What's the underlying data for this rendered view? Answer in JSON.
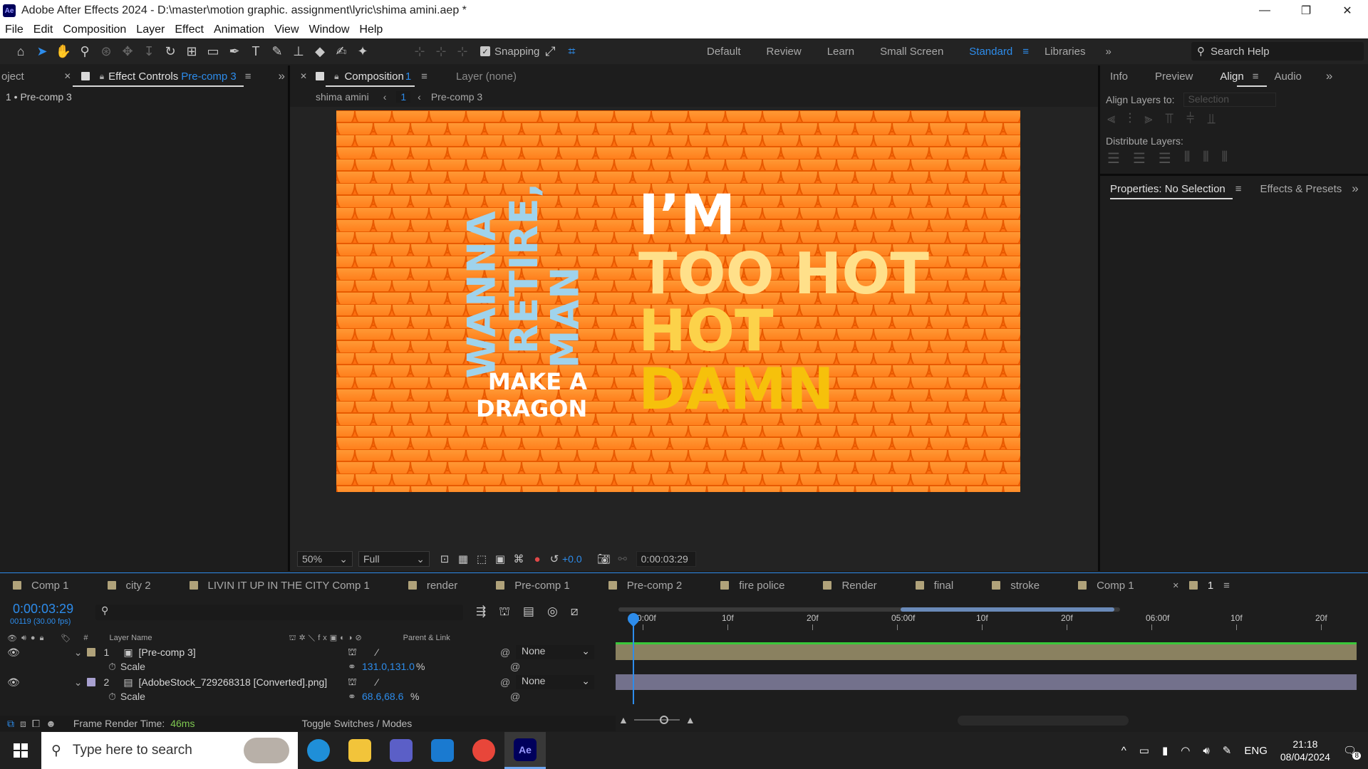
{
  "window": {
    "title": "Adobe After Effects 2024 - D:\\master\\motion graphic. assignment\\lyric\\shima amini.aep *",
    "logo": "Ae",
    "minimize": "—",
    "maximize": "❐",
    "close": "✕"
  },
  "menu": [
    "File",
    "Edit",
    "Composition",
    "Layer",
    "Effect",
    "Animation",
    "View",
    "Window",
    "Help"
  ],
  "toolbar": {
    "snapping_label": "Snapping",
    "snapping_checked": true,
    "icons": [
      "home-icon",
      "selection-icon",
      "hand-icon",
      "zoom-icon",
      "orbit-icon",
      "pan-icon",
      "dolly-icon",
      "rotate-icon",
      "anchor-icon",
      "rectangle-icon",
      "pen-icon",
      "type-icon",
      "brush-icon",
      "clone-stamp-icon",
      "eraser-icon",
      "roto-brush-icon",
      "puppet-pin-icon"
    ]
  },
  "workspaces": {
    "items": [
      "Default",
      "Review",
      "Learn",
      "Small Screen",
      "Standard",
      "Libraries"
    ],
    "current": "Standard",
    "more": "»"
  },
  "search_help": {
    "placeholder": "Search Help"
  },
  "left_panel": {
    "tab_project": "oject",
    "tab_effects": "Effect Controls",
    "tab_effects_target": "Pre-comp 3",
    "breadcrumb": "1 • Pre-comp 3"
  },
  "center_panel": {
    "tab_composition": "Composition",
    "tab_composition_num": "1",
    "tab_layer": "Layer  (none)",
    "crumb_root": "shima amini",
    "crumb_index": "1",
    "crumb_current": "Pre-comp 3"
  },
  "viewer": {
    "vertical_words": [
      "WANNA",
      "RETIRE,",
      "MAN"
    ],
    "make_a": "MAKE A",
    "dragon": "DRAGON",
    "im": "I’M",
    "too_hot": "TOO HOT",
    "hot": "HOT",
    "damn": "DAMN",
    "bg_color": "#ff7a1a",
    "text_blue": "#9fd3ec",
    "text_white": "#ffffff",
    "text_cream": "#ffe08a",
    "text_yellow": "#f6c10b"
  },
  "viewer_bar": {
    "zoom": "50%",
    "resolution": "Full",
    "exposure": "+0.0",
    "timecode": "0:00:03:29"
  },
  "right_panel": {
    "tabs": [
      "Info",
      "Preview",
      "Align",
      "Audio"
    ],
    "active_tab": "Align",
    "align_layers_to": "Align Layers to:",
    "align_target": "Selection",
    "distribute_layers": "Distribute Layers:",
    "tab_properties": "Properties: No Selection",
    "tab_effects_presets": "Effects & Presets"
  },
  "timeline": {
    "tabs": [
      {
        "label": "Comp 1",
        "color": "#b0a27a"
      },
      {
        "label": "city 2",
        "color": "#b0a27a"
      },
      {
        "label": "LIVIN IT UP IN THE CITY Comp 1",
        "color": "#b0a27a"
      },
      {
        "label": "render",
        "color": "#b0a27a"
      },
      {
        "label": "Pre-comp 1",
        "color": "#b0a27a"
      },
      {
        "label": "Pre-comp 2",
        "color": "#b0a27a"
      },
      {
        "label": "fire police",
        "color": "#b0a27a"
      },
      {
        "label": "Render",
        "color": "#b0a27a"
      },
      {
        "label": "final",
        "color": "#b0a27a"
      },
      {
        "label": "stroke",
        "color": "#b0a27a"
      },
      {
        "label": "Comp 1",
        "color": "#b0a27a"
      },
      {
        "label": "1",
        "color": "#b0a27a",
        "active": true
      }
    ],
    "current_time": "0:00:03:29",
    "frame_info": "00119 (30.00 fps)",
    "col_hash": "#",
    "col_layer_name": "Layer Name",
    "col_parent": "Parent & Link",
    "ruler_labels": [
      "0:00f",
      "10f",
      "20f",
      "05:00f",
      "10f",
      "20f",
      "06:00f",
      "10f",
      "20f"
    ],
    "layers": [
      {
        "num": "1",
        "name": "[Pre-comp 3]",
        "color": "#b0a27a",
        "parent": "None",
        "prop": "Scale",
        "value": "131.0,131.0",
        "unit": "%",
        "bar_color": "#8a8160"
      },
      {
        "num": "2",
        "name": "[AdobeStock_729268318 [Converted].png]",
        "color": "#a8a0d0",
        "parent": "None",
        "prop": "Scale",
        "value": "68.6,68.6",
        "unit": "%",
        "bar_color": "#73718c"
      }
    ],
    "footer_render_label": "Frame Render Time:",
    "footer_render_value": "46ms",
    "footer_toggle": "Toggle Switches / Modes"
  },
  "taskbar": {
    "search_placeholder": "Type here to search",
    "language": "ENG",
    "time": "21:18",
    "date": "08/04/2024",
    "notifications": "8",
    "apps": [
      "edge-icon",
      "file-explorer-icon",
      "teams-icon",
      "mail-icon",
      "chrome-icon",
      "after-effects-icon"
    ]
  }
}
